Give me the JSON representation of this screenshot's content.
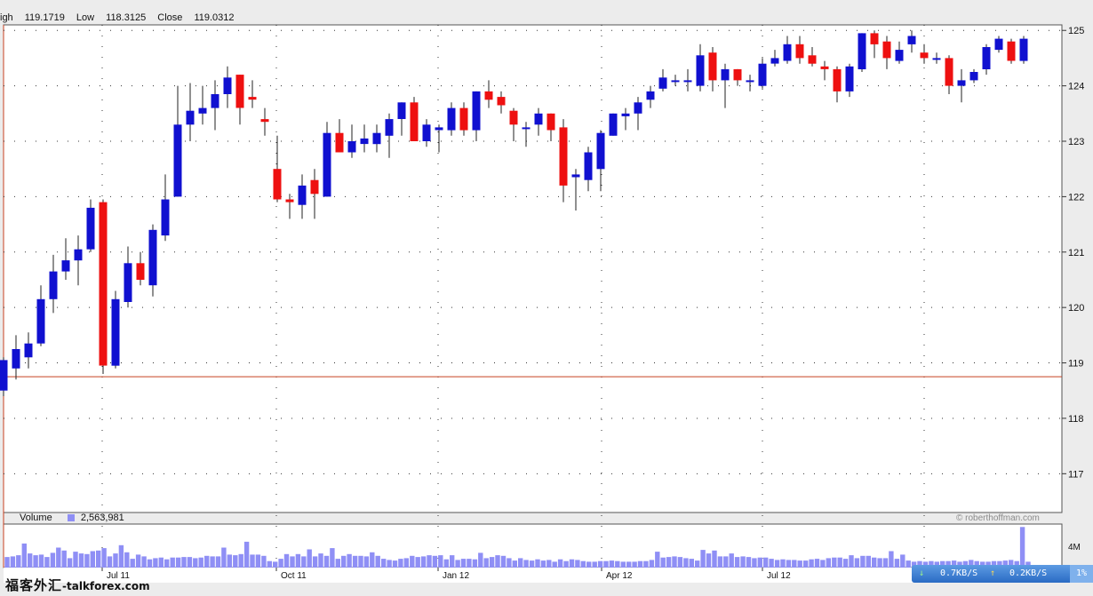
{
  "header": {
    "high_label": "igh",
    "high_value": "119.1719",
    "low_label": "Low",
    "low_value": "118.3125",
    "close_label": "Close",
    "close_value": "119.0312"
  },
  "volume_header": {
    "label": "Volume",
    "value": "2,563,981"
  },
  "credit": "© roberthoffman.com",
  "watermark": {
    "chinese": "福客外汇",
    "url": "-talkforex.com"
  },
  "network": {
    "down": "0.7KB/S",
    "up": "0.2KB/S",
    "percent": "1%"
  },
  "colors": {
    "up": "#1010d0",
    "down": "#ee1010",
    "volume": "#8f8ff5",
    "reference_line": "#c84020"
  },
  "chart_data": {
    "type": "candlestick",
    "title": "",
    "xlabel": "",
    "ylabel": "",
    "ylim": [
      116.3,
      125.1
    ],
    "y_ticks": [
      117,
      118,
      119,
      120,
      121,
      122,
      123,
      124,
      125
    ],
    "x_tick_labels": [
      "Jul 11",
      "Oct 11",
      "Jan 12",
      "Apr 12",
      "Jul 12"
    ],
    "reference_line": 118.75,
    "grid": true,
    "volume_tick_label": "4M",
    "volume_ylim": [
      0,
      7.4
    ],
    "candles": [
      [
        118.5,
        119.05,
        118.4,
        119.1
      ],
      [
        118.9,
        119.25,
        118.7,
        119.5
      ],
      [
        119.1,
        119.35,
        118.9,
        119.55
      ],
      [
        119.35,
        120.15,
        119.3,
        120.4
      ],
      [
        120.15,
        120.65,
        119.9,
        120.95
      ],
      [
        120.65,
        120.85,
        120.5,
        121.25
      ],
      [
        120.85,
        121.05,
        120.4,
        121.3
      ],
      [
        121.05,
        121.8,
        121,
        121.95
      ],
      [
        121.9,
        118.95,
        118.8,
        121.95
      ],
      [
        118.95,
        120.15,
        118.9,
        120.3
      ],
      [
        120.1,
        120.8,
        120,
        121.1
      ],
      [
        120.8,
        120.5,
        120.4,
        121
      ],
      [
        120.4,
        121.4,
        120.2,
        121.5
      ],
      [
        121.3,
        121.95,
        121.2,
        122.4
      ],
      [
        122,
        123.3,
        122,
        124
      ],
      [
        123.3,
        123.55,
        123,
        124.05
      ],
      [
        123.5,
        123.6,
        123.3,
        124
      ],
      [
        123.6,
        123.85,
        123.2,
        124.1
      ],
      [
        123.85,
        124.15,
        123.6,
        124.35
      ],
      [
        124.2,
        123.6,
        123.3,
        124.2
      ],
      [
        123.8,
        123.75,
        123.6,
        124.1
      ],
      [
        123.4,
        123.35,
        123.1,
        123.6
      ],
      [
        122.5,
        121.95,
        121.9,
        123.1
      ],
      [
        121.95,
        121.9,
        121.6,
        122.05
      ],
      [
        121.85,
        122.2,
        121.6,
        122.4
      ],
      [
        122.3,
        122.05,
        121.6,
        122.5
      ],
      [
        122,
        123.15,
        122,
        123.35
      ],
      [
        123.15,
        122.8,
        122.8,
        123.4
      ],
      [
        122.8,
        123,
        122.7,
        123.3
      ],
      [
        122.95,
        123.05,
        122.8,
        123.3
      ],
      [
        122.95,
        123.15,
        122.8,
        123.3
      ],
      [
        123.1,
        123.4,
        122.7,
        123.5
      ],
      [
        123.4,
        123.7,
        123.1,
        123.7
      ],
      [
        123.7,
        123,
        123,
        123.8
      ],
      [
        123,
        123.3,
        122.9,
        123.4
      ],
      [
        123.2,
        123.25,
        122.8,
        123.3
      ],
      [
        123.2,
        123.6,
        123.1,
        123.7
      ],
      [
        123.6,
        123.2,
        123.1,
        123.7
      ],
      [
        123.2,
        123.9,
        123,
        123.9
      ],
      [
        123.9,
        123.75,
        123.6,
        124.1
      ],
      [
        123.8,
        123.65,
        123.5,
        123.9
      ],
      [
        123.55,
        123.3,
        123,
        123.6
      ],
      [
        123.25,
        123.25,
        122.9,
        123.35
      ],
      [
        123.3,
        123.5,
        123.1,
        123.6
      ],
      [
        123.5,
        123.2,
        123,
        123.5
      ],
      [
        123.25,
        122.2,
        121.9,
        123.4
      ],
      [
        122.35,
        122.4,
        121.75,
        122.5
      ],
      [
        122.3,
        122.8,
        122.1,
        122.9
      ],
      [
        122.5,
        123.15,
        122.1,
        123.2
      ],
      [
        123.1,
        123.5,
        123.1,
        123.5
      ],
      [
        123.45,
        123.5,
        123.2,
        123.6
      ],
      [
        123.5,
        123.7,
        123.2,
        123.8
      ],
      [
        123.75,
        123.9,
        123.6,
        124
      ],
      [
        123.95,
        124.15,
        123.9,
        124.3
      ],
      [
        124.1,
        124.1,
        124,
        124.2
      ],
      [
        124.1,
        124.1,
        123.9,
        124.3
      ],
      [
        124,
        124.55,
        123.9,
        124.75
      ],
      [
        124.6,
        124.1,
        123.9,
        124.7
      ],
      [
        124.1,
        124.3,
        123.6,
        124.4
      ],
      [
        124.3,
        124.1,
        124,
        124.3
      ],
      [
        124.1,
        124.1,
        123.9,
        124.2
      ],
      [
        124,
        124.4,
        123.95,
        124.5
      ],
      [
        124.4,
        124.5,
        124.35,
        124.65
      ],
      [
        124.45,
        124.75,
        124.4,
        124.9
      ],
      [
        124.75,
        124.5,
        124.4,
        124.9
      ],
      [
        124.55,
        124.4,
        124.35,
        124.7
      ],
      [
        124.35,
        124.3,
        124.1,
        124.45
      ],
      [
        124.3,
        123.9,
        123.7,
        124.35
      ],
      [
        123.9,
        124.35,
        123.8,
        124.4
      ],
      [
        124.3,
        124.95,
        124.25,
        124.95
      ],
      [
        124.95,
        124.75,
        124.5,
        125
      ],
      [
        124.8,
        124.5,
        124.3,
        124.9
      ],
      [
        124.45,
        124.65,
        124.4,
        124.8
      ],
      [
        124.75,
        124.9,
        124.6,
        125
      ],
      [
        124.6,
        124.5,
        124.4,
        124.75
      ],
      [
        124.5,
        124.5,
        124.4,
        124.6
      ],
      [
        124.5,
        124,
        123.85,
        124.55
      ],
      [
        124,
        124.1,
        123.7,
        124.3
      ],
      [
        124.1,
        124.25,
        124.05,
        124.3
      ],
      [
        124.3,
        124.7,
        124.2,
        124.75
      ],
      [
        124.65,
        124.85,
        124.6,
        124.9
      ],
      [
        124.8,
        124.45,
        124.4,
        124.85
      ],
      [
        124.45,
        124.85,
        124.4,
        124.9
      ]
    ],
    "volume_values": [
      1.8,
      1.9,
      2.1,
      4.1,
      2.4,
      2.1,
      2.2,
      1.8,
      2.5,
      3.4,
      2.9,
      1.6,
      2.7,
      2.4,
      2.3,
      2.8,
      2.9,
      3.3,
      1.9,
      2.4,
      3.8,
      2.6,
      1.5,
      2.2,
      1.9,
      1.4,
      1.6,
      1.7,
      1.4,
      1.7,
      1.7,
      1.8,
      1.8,
      1.6,
      1.7,
      2.0,
      1.9,
      1.9,
      3.4,
      2.2,
      2.1,
      2.3,
      4.4,
      2.2,
      2.2,
      2.0,
      1.1,
      1.0,
      1.5,
      2.3,
      1.9,
      2.3,
      1.9,
      3.1,
      1.9,
      2.4,
      2.0,
      3.3,
      1.5,
      2.0,
      2.3,
      2.0,
      2.0,
      1.9,
      2.6,
      2.0,
      1.5,
      1.3,
      1.2,
      1.5,
      1.6,
      2.0,
      1.8,
      1.9,
      2.1,
      2.0,
      2.1,
      1.4,
      2.1,
      1.3,
      1.5,
      1.5,
      1.4,
      2.5,
      1.6,
      1.8,
      2.1,
      2.0,
      1.6,
      1.2,
      1.6,
      1.3,
      1.2,
      1.4,
      1.2,
      1.3,
      1.0,
      1.4,
      1.1,
      1.4,
      1.3,
      1.1,
      1.0,
      1.0,
      1.1,
      1.1,
      1.2,
      1.1,
      1.0,
      1.0,
      1.0,
      1.1,
      1.1,
      1.3,
      2.7,
      1.7,
      1.8,
      1.9,
      1.8,
      1.6,
      1.5,
      1.2,
      3.0,
      2.4,
      2.9,
      1.9,
      1.9,
      2.4,
      1.8,
      1.9,
      1.8,
      1.6,
      1.7,
      1.7,
      1.5,
      1.3,
      1.4,
      1.3,
      1.3,
      1.2,
      1.2,
      1.4,
      1.5,
      1.3,
      1.6,
      1.7,
      1.7,
      1.5,
      2.1,
      1.6,
      2.0,
      2.0,
      1.7,
      1.6,
      1.6,
      2.8,
      1.5,
      2.2,
      1.2,
      1.0,
      1.1,
      1.0,
      1.1,
      1.0,
      1.1,
      1.1,
      1.2,
      1.0,
      1.1,
      1.3,
      1.1,
      1.0,
      1.0,
      1.1,
      1.1,
      1.2,
      1.3,
      1.1,
      6.9,
      1.0
    ]
  }
}
